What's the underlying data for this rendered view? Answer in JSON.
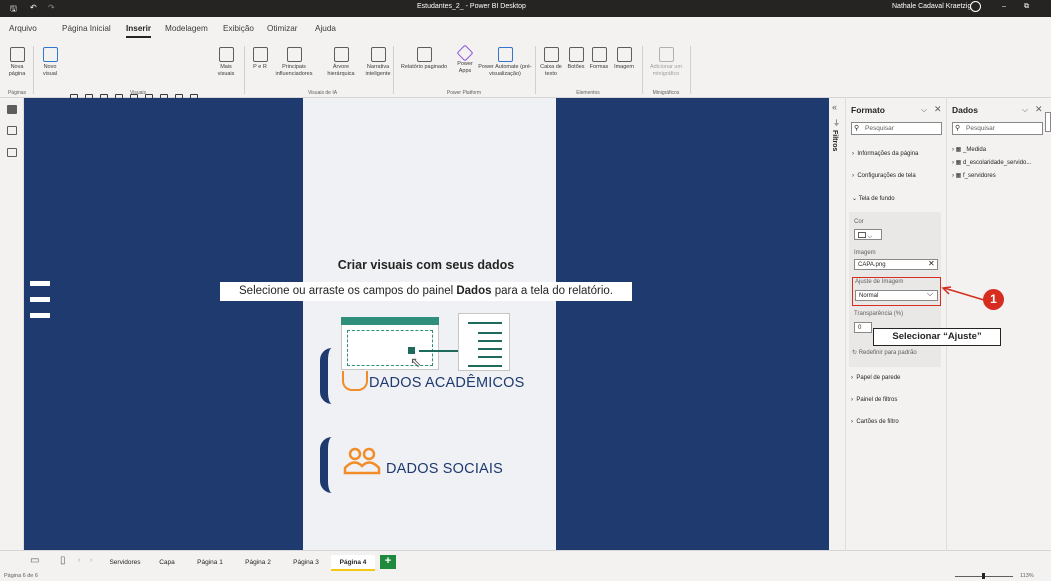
{
  "window": {
    "title": "Estudantes_2_ - Power BI Desktop",
    "user": "Nathale Cadaval Kraetzig",
    "minimize": "–",
    "restore": "⧉"
  },
  "menu": [
    "Arquivo",
    "Página Inicial",
    "Inserir",
    "Modelagem",
    "Exibição",
    "Otimizar",
    "Ajuda"
  ],
  "menu_active": "Inserir",
  "ribbon": {
    "paginas": {
      "nova_pagina": "Nova página",
      "group": "Páginas"
    },
    "visuais": {
      "novo_visual": "Novo visual",
      "mais_visuais": "Mais visuais",
      "group": "Visuais"
    },
    "ia": {
      "pe_r": "P e R",
      "principais": "Principais influenciadores",
      "arvore": "Árvore hierárquica",
      "narrativa": "Narrativa inteligente",
      "group": "Visuais de IA"
    },
    "pp": {
      "relatorio": "Relatório paginado",
      "powerapps": "Power Apps",
      "automate": "Power Automate (pré-visualização)",
      "group": "Power Platform"
    },
    "elementos": {
      "caixa": "Caixa de texto",
      "botoes": "Botões",
      "formas": "Formas",
      "imagem": "Imagem",
      "group": "Elementos"
    },
    "minigraficos": {
      "adicionar": "Adicionar um minigráfico",
      "group": "Minigráficos"
    }
  },
  "canvas": {
    "title": "Criar visuais com seus dados",
    "subtitle_pre": "Selecione ou arraste os campos do painel ",
    "subtitle_bold": "Dados",
    "subtitle_post": " para a tela do relatório.",
    "card1": "DADOS ACADÊMICOS",
    "card2": "DADOS SOCIAIS"
  },
  "filters_label": "Filtros",
  "format_panel": {
    "title": "Formato",
    "search": "Pesquisar",
    "sections": [
      "Informações da página",
      "Configurações de tela"
    ],
    "bg_section": "Tela de fundo",
    "cor_label": "Cor",
    "imagem_label": "Imagem",
    "imagem_value": "CAPA.png",
    "ajuste_label": "Ajuste de Imagem",
    "ajuste_value": "Normal",
    "transp_label": "Transparência (%)",
    "transp_value": "0",
    "reset": "Redefinir para padrão",
    "more_sections": [
      "Papel de parede",
      "Painel de filtros",
      "Cartões de filtro"
    ]
  },
  "data_panel": {
    "title": "Dados",
    "search": "Pesquisar",
    "tables": [
      "_Medida",
      "d_escolaridade_servido...",
      "f_servidores"
    ]
  },
  "annotation": {
    "number": "1",
    "label": "Selecionar “Ajuste”"
  },
  "tabs": [
    "Servidores",
    "Capa",
    "Página 1",
    "Página 2",
    "Página 3",
    "Página 4"
  ],
  "active_tab": "Página 4",
  "add_tab": "+",
  "status": {
    "page": "Página 6 de 6",
    "zoom": "113%"
  },
  "colors": {
    "navy": "#1e3a6e",
    "accent_orange": "#f28c28",
    "annotation_red": "#d62d20",
    "tab_highlight": "#f2c811"
  }
}
